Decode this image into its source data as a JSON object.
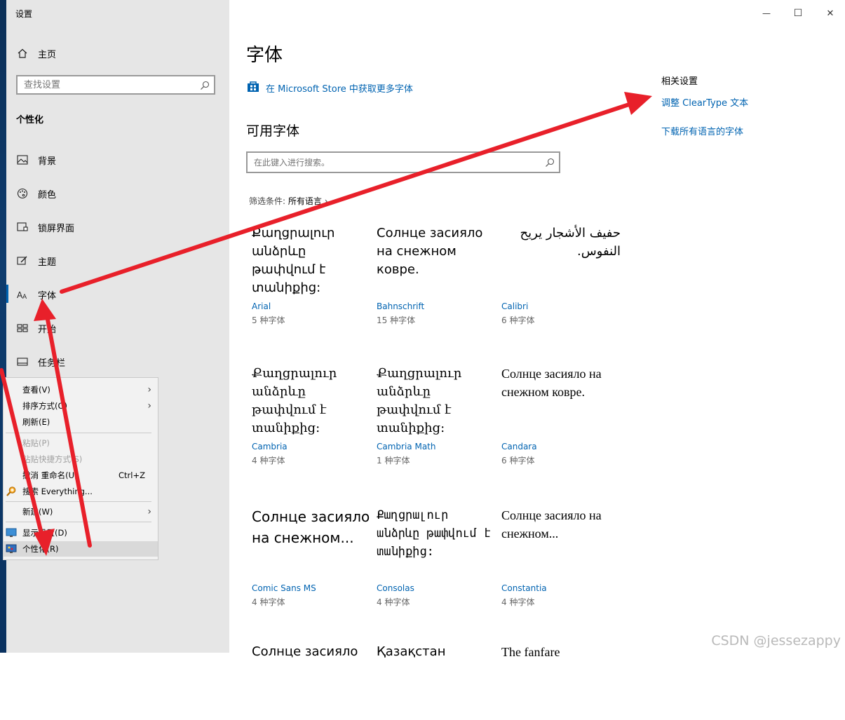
{
  "window": {
    "title": "设置",
    "minimize": "—",
    "maximize": "☐",
    "close": "✕"
  },
  "sidebar": {
    "home": "主页",
    "search_placeholder": "查找设置",
    "section": "个性化",
    "items": [
      {
        "label": "背景",
        "icon": "picture-icon"
      },
      {
        "label": "颜色",
        "icon": "palette-icon"
      },
      {
        "label": "锁屏界面",
        "icon": "lock-screen-icon"
      },
      {
        "label": "主题",
        "icon": "theme-icon"
      },
      {
        "label": "字体",
        "icon": "font-icon",
        "active": true
      },
      {
        "label": "开始",
        "icon": "start-icon"
      },
      {
        "label": "任务栏",
        "icon": "taskbar-icon"
      }
    ]
  },
  "main": {
    "title": "字体",
    "store_link": "在 Microsoft Store 中获取更多字体",
    "available_title": "可用字体",
    "search_placeholder": "在此键入进行搜索。",
    "filter_label": "筛选条件:",
    "filter_value": "所有语言",
    "filter_arrow": "›",
    "related": {
      "title": "相关设置",
      "links": [
        "调整 ClearType 文本",
        "下载所有语言的字体"
      ]
    },
    "fonts": [
      {
        "sample": "Քաղցրալուր անձրևը թափվում է տանիքից:",
        "name": "Arial",
        "count": "5 种字体"
      },
      {
        "sample": "Солнце засияло на снежном ковре.",
        "name": "Bahnschrift",
        "count": "15 种字体"
      },
      {
        "sample": "حفيف الأشجار يريح النفوس.",
        "name": "Calibri",
        "count": "6 种字体"
      },
      {
        "sample": "Քաղցրալուր անձրևը թափվում է տանիքից:",
        "name": "Cambria",
        "count": "4 种字体"
      },
      {
        "sample": "Քաղցրալուր անձրևը թափվում է տանիքից:",
        "name": "Cambria Math",
        "count": "1 种字体"
      },
      {
        "sample": "Солнце засияло на снежном ковре.",
        "name": "Candara",
        "count": "6 种字体"
      },
      {
        "sample": "Солнце засияло на снежном...",
        "name": "Comic Sans MS",
        "count": "4 种字体"
      },
      {
        "sample": "Քաղցրալուր անձրևը թափվում է տանիքից:",
        "name": "Consolas",
        "count": "4 种字体"
      },
      {
        "sample": "Солнце засияло на снежном...",
        "name": "Constantia",
        "count": "4 种字体"
      }
    ],
    "partial_row": [
      "Солнце засияло",
      "Қазақстан",
      "The fanfare"
    ]
  },
  "context_menu": {
    "view": "查看(V)",
    "sort": "排序方式(O)",
    "refresh": "刷新(E)",
    "paste": "粘贴(P)",
    "paste_shortcut": "粘贴快捷方式(S)",
    "undo": "撤消 重命名(U)",
    "undo_shortcut": "Ctrl+Z",
    "search_everything": "搜索 Everything...",
    "new": "新建(W)",
    "display": "显示设置(D)",
    "personalize": "个性化(R)"
  },
  "watermark": "CSDN @jessezappy",
  "colors": {
    "accent": "#0063b1",
    "sidebar_bg": "#e6e6e6",
    "annotation": "#e8202a"
  }
}
